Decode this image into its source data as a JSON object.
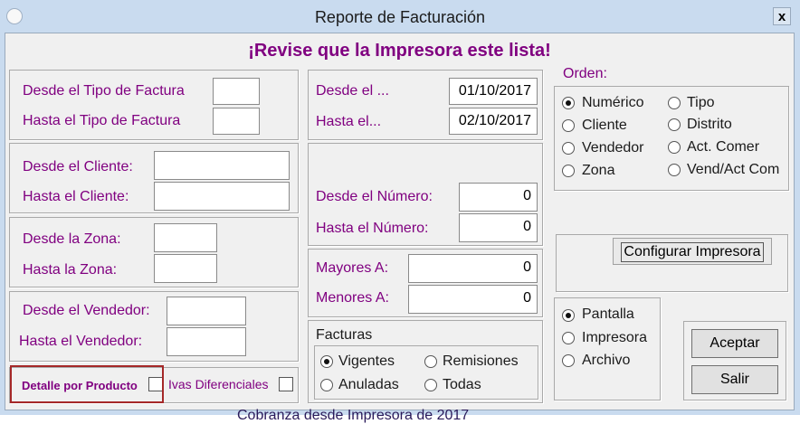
{
  "window": {
    "title": "Reporte de Facturación",
    "close_label": "x"
  },
  "banner": "¡Revise que la Impresora este lista!",
  "tipo_factura": {
    "desde_label": "Desde el Tipo de Factura",
    "hasta_label": "Hasta el Tipo de Factura",
    "desde_value": "",
    "hasta_value": ""
  },
  "cliente": {
    "desde_label": "Desde el Cliente:",
    "hasta_label": "Hasta el Cliente:",
    "desde_value": "",
    "hasta_value": ""
  },
  "zona": {
    "desde_label": "Desde la Zona:",
    "hasta_label": "Hasta la Zona:",
    "desde_value": "",
    "hasta_value": ""
  },
  "vendedor": {
    "desde_label": "Desde el Vendedor:",
    "hasta_label": "Hasta el Vendedor:",
    "desde_value": "",
    "hasta_value": ""
  },
  "fecha": {
    "desde_label": "Desde el ...",
    "hasta_label": "Hasta el...",
    "desde_value": "01/10/2017",
    "hasta_value": "02/10/2017"
  },
  "numero": {
    "desde_label": "Desde el Número:",
    "hasta_label": "Hasta el Número:",
    "desde_value": "0",
    "hasta_value": "0"
  },
  "monto": {
    "mayores_label": "Mayores A:",
    "menores_label": "Menores A:",
    "mayores_value": "0",
    "menores_value": "0"
  },
  "facturas": {
    "title": "Facturas",
    "options": [
      "Vigentes",
      "Remisiones",
      "Anuladas",
      "Todas"
    ],
    "selected": "Vigentes"
  },
  "orden": {
    "title": "Orden:",
    "options": [
      "Numérico",
      "Tipo",
      "Cliente",
      "Distrito",
      "Vendedor",
      "Act. Comer",
      "Zona",
      "Vend/Act Com"
    ],
    "selected": "Numérico"
  },
  "configurar_label": "Configurar Impresora",
  "salida": {
    "options": [
      "Pantalla",
      "Impresora",
      "Archivo"
    ],
    "selected": "Pantalla"
  },
  "aceptar_label": "Aceptar",
  "salir_label": "Salir",
  "detalle_label": "Detalle por Producto",
  "ivas_label": "Ivas Diferenciales",
  "background_text": "Cobranza desde Impresora de 2017"
}
